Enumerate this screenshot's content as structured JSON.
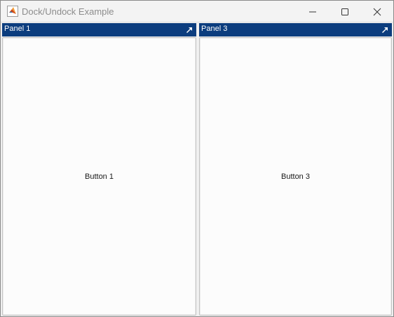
{
  "window": {
    "title": "Dock/Undock Example",
    "controls": {
      "minimize_icon": "minimize-icon",
      "maximize_icon": "maximize-icon",
      "close_icon": "close-icon"
    }
  },
  "panels": [
    {
      "title": "Panel 1",
      "button_label": "Button 1",
      "undock_icon": "undock-arrow-icon"
    },
    {
      "title": "Panel 3",
      "button_label": "Button 3",
      "undock_icon": "undock-arrow-icon"
    }
  ],
  "colors": {
    "panel_header": "#0c3d7e",
    "panel_header_text": "#ffffff",
    "title_text": "#8c8c8c",
    "panel_background": "#fcfcfc"
  }
}
